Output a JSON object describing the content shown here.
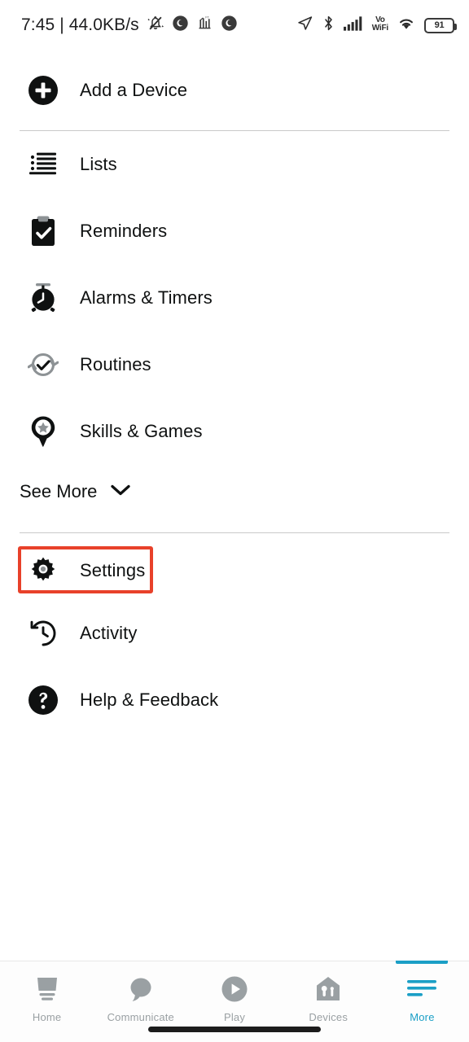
{
  "status_bar": {
    "time": "7:45",
    "separator": "|",
    "network_speed": "44.0KB/s",
    "left_icons": [
      "mute-bell-icon",
      "dnd-circle-icon",
      "signal-bars-circle-icon",
      "dnd-circle-icon-2"
    ],
    "right_icons": [
      "location-arrow-icon",
      "bluetooth-icon",
      "cellular-signal-icon",
      "vowifi-icon",
      "wifi-icon",
      "battery-icon"
    ],
    "vo_text": "Vo",
    "wifi_text": "WiFi",
    "battery_level": "91"
  },
  "menu": {
    "add_device": {
      "label": "Add a Device",
      "icon": "plus-circle-icon"
    },
    "primary_items": [
      {
        "label": "Lists",
        "icon": "list-icon"
      },
      {
        "label": "Reminders",
        "icon": "clipboard-check-icon"
      },
      {
        "label": "Alarms & Timers",
        "icon": "alarm-clock-icon"
      },
      {
        "label": "Routines",
        "icon": "routines-refresh-check-icon"
      },
      {
        "label": "Skills & Games",
        "icon": "skills-pin-star-icon"
      }
    ],
    "see_more": {
      "label": "See More",
      "icon": "chevron-down-icon"
    },
    "secondary_items": [
      {
        "label": "Settings",
        "icon": "gear-icon",
        "highlighted": true
      },
      {
        "label": "Activity",
        "icon": "clock-history-icon",
        "highlighted": false
      },
      {
        "label": "Help & Feedback",
        "icon": "question-circle-icon",
        "highlighted": false
      }
    ]
  },
  "bottom_nav": {
    "tabs": [
      {
        "label": "Home",
        "icon": "echo-show-device-icon",
        "active": false
      },
      {
        "label": "Communicate",
        "icon": "speech-bubble-icon",
        "active": false
      },
      {
        "label": "Play",
        "icon": "play-circle-icon",
        "active": false
      },
      {
        "label": "Devices",
        "icon": "home-devices-icon",
        "active": false
      },
      {
        "label": "More",
        "icon": "hamburger-more-icon",
        "active": true
      }
    ]
  },
  "colors": {
    "accent": "#1b9fc6",
    "highlight_border": "#e8412a",
    "icon_dark": "#0f1111",
    "icon_gray": "#9aa0a3",
    "divider": "#c9c9c9",
    "text": "#0f1111"
  }
}
